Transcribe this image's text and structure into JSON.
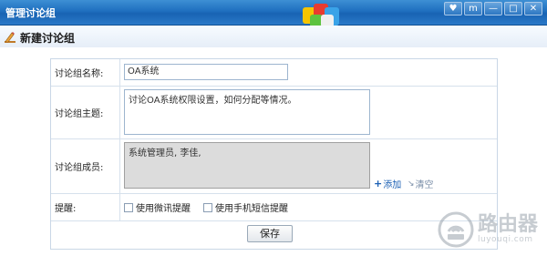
{
  "window": {
    "title": "管理讨论组",
    "buttons": [
      {
        "name": "heart-icon",
        "glyph": "♥"
      },
      {
        "name": "bookmark-icon",
        "glyph": "m"
      },
      {
        "name": "minimize-icon",
        "glyph": "—"
      },
      {
        "name": "maximize-icon",
        "glyph": "□"
      },
      {
        "name": "close-icon",
        "glyph": "✕"
      }
    ]
  },
  "header": {
    "title": "新建讨论组"
  },
  "form": {
    "name_label": "讨论组名称:",
    "name_value": "OA系统",
    "topic_label": "讨论组主题:",
    "topic_value": "讨论OA系统权限设置，如何分配等情况。",
    "members_label": "讨论组成员:",
    "members_value": "系统管理员, 李佳,",
    "add_label": "添加",
    "clear_label": "清空",
    "remind_label": "提醒:",
    "remind_options": [
      "使用微讯提醒",
      "使用手机短信提醒"
    ],
    "save_label": "保存"
  },
  "watermark": {
    "main": "路由器",
    "sub": "luyouqi.com"
  }
}
